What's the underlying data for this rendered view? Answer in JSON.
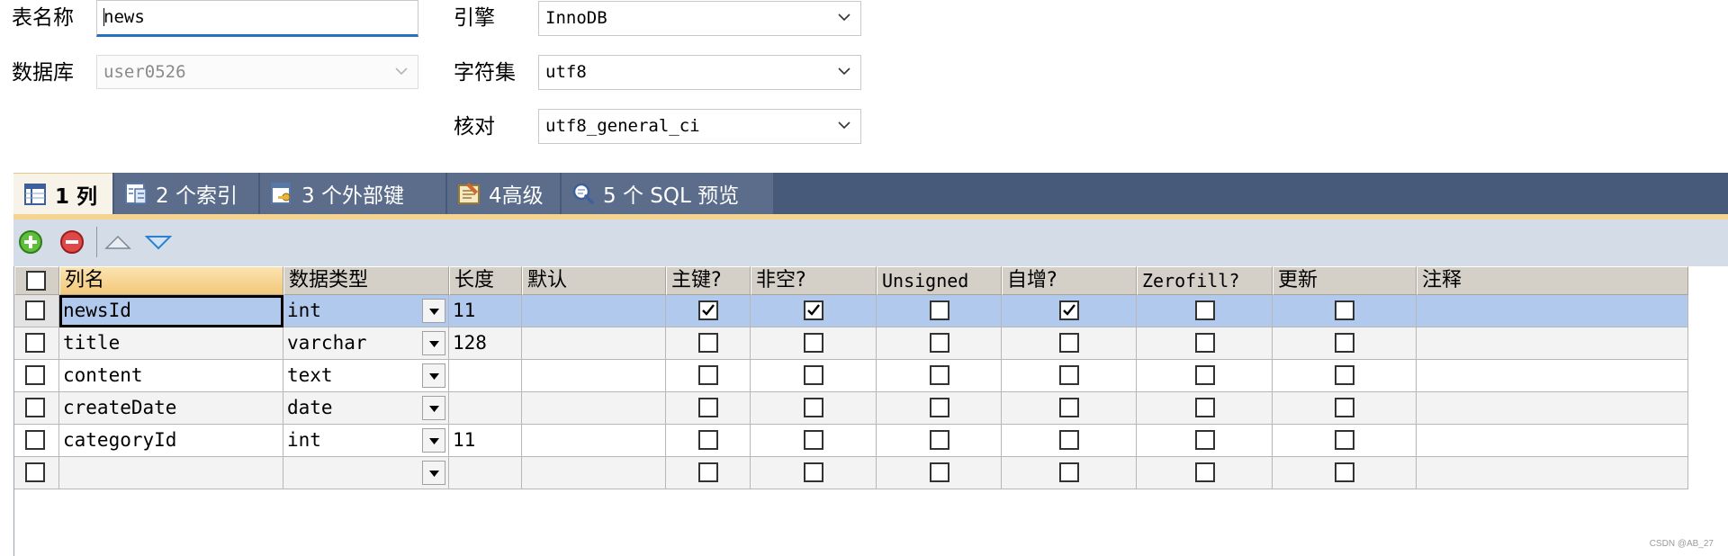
{
  "form": {
    "table_name_label": "表名称",
    "table_name_value": "news",
    "database_label": "数据库",
    "database_value": "user0526",
    "engine_label": "引擎",
    "engine_value": "InnoDB",
    "charset_label": "字符集",
    "charset_value": "utf8",
    "collation_label": "核对",
    "collation_value": "utf8_general_ci"
  },
  "tabs": [
    {
      "label": "1 列",
      "icon": "columns-icon",
      "active": true
    },
    {
      "label": "2 个索引",
      "icon": "index-icon",
      "active": false
    },
    {
      "label": "3 个外部键",
      "icon": "foreign-key-icon",
      "active": false
    },
    {
      "label": "4高级",
      "icon": "advanced-icon",
      "active": false
    },
    {
      "label": "5 个 SQL 预览",
      "icon": "sql-preview-icon",
      "active": false
    }
  ],
  "toolbar": {
    "buttons": [
      "add-column-icon",
      "remove-column-icon",
      "move-up-icon",
      "move-down-icon"
    ]
  },
  "grid": {
    "headers": {
      "name": "列名",
      "type": "数据类型",
      "length": "长度",
      "default": "默认",
      "primary_key": "主键?",
      "not_null": "非空?",
      "unsigned": "Unsigned",
      "auto_increment": "自增?",
      "zerofill": "Zerofill?",
      "update": "更新",
      "comment": "注释"
    },
    "rows": [
      {
        "name": "newsId",
        "type": "int",
        "length": "11",
        "default": "",
        "pk": true,
        "nn": true,
        "unsigned": false,
        "ai": true,
        "zf": false,
        "upd": false,
        "comment": ""
      },
      {
        "name": "title",
        "type": "varchar",
        "length": "128",
        "default": "",
        "pk": false,
        "nn": false,
        "unsigned": false,
        "ai": false,
        "zf": false,
        "upd": false,
        "comment": ""
      },
      {
        "name": "content",
        "type": "text",
        "length": "",
        "default": "",
        "pk": false,
        "nn": false,
        "unsigned": false,
        "ai": false,
        "zf": false,
        "upd": false,
        "comment": ""
      },
      {
        "name": "createDate",
        "type": "date",
        "length": "",
        "default": "",
        "pk": false,
        "nn": false,
        "unsigned": false,
        "ai": false,
        "zf": false,
        "upd": false,
        "comment": ""
      },
      {
        "name": "categoryId",
        "type": "int",
        "length": "11",
        "default": "",
        "pk": false,
        "nn": false,
        "unsigned": false,
        "ai": false,
        "zf": false,
        "upd": false,
        "comment": ""
      },
      {
        "name": "",
        "type": "",
        "length": "",
        "default": "",
        "pk": false,
        "nn": false,
        "unsigned": false,
        "ai": false,
        "zf": false,
        "upd": false,
        "comment": ""
      }
    ]
  },
  "watermark": "CSDN @AB_27",
  "colors": {
    "tab_bar": "#475a79",
    "tab_active": "#f7f3e8",
    "toolbar": "#d3dce7",
    "row_selected": "#b1c9ec",
    "focus_underline": "#2a6fbd"
  }
}
